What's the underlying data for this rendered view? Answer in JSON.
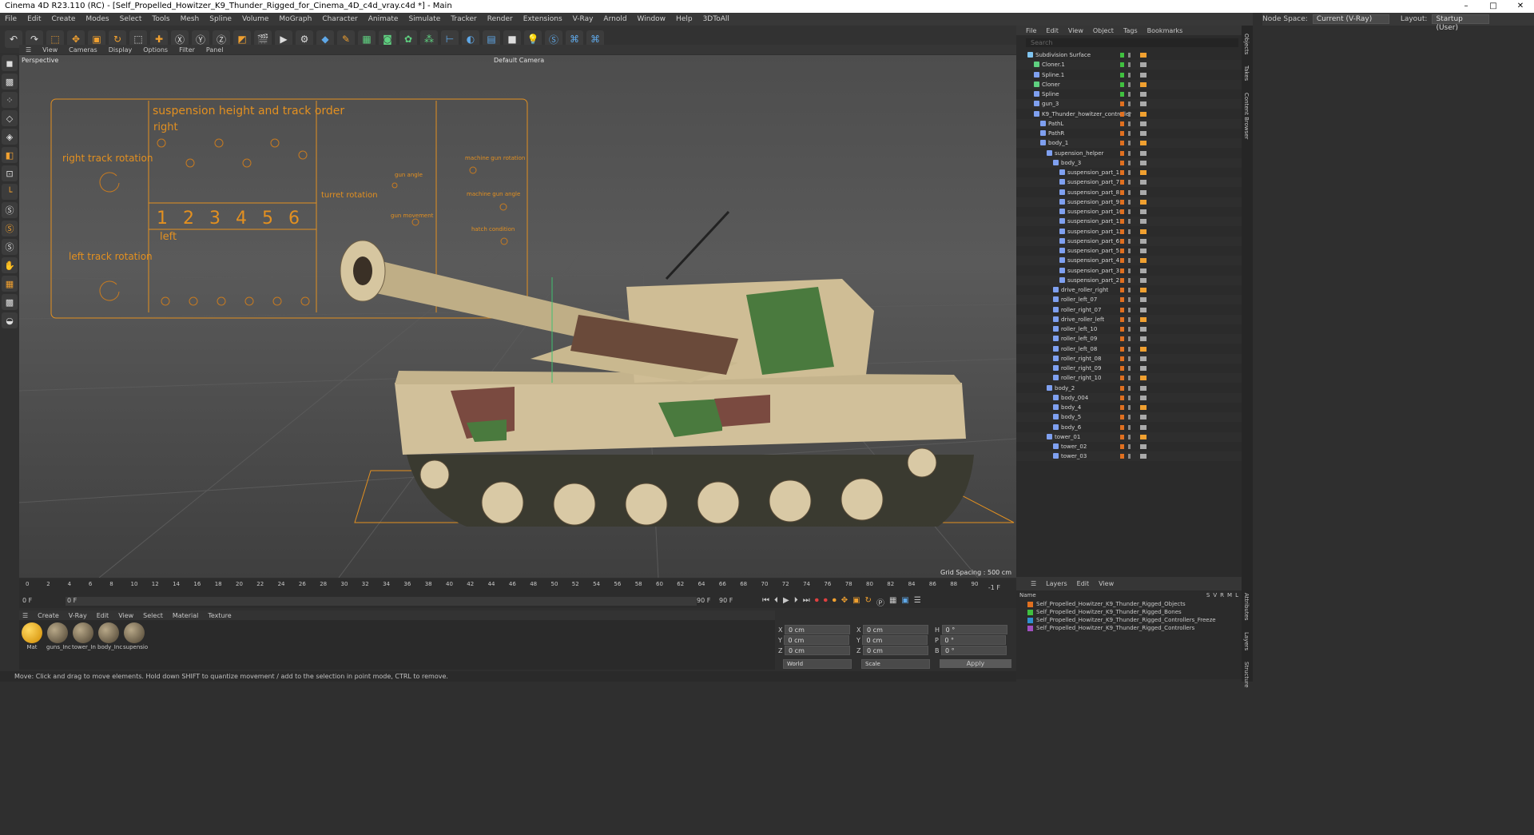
{
  "window": {
    "title": "Cinema 4D R23.110 (RC) - [Self_Propelled_Howitzer_K9_Thunder_Rigged_for_Cinema_4D_c4d_vray.c4d *] - Main"
  },
  "menu": [
    "File",
    "Edit",
    "Create",
    "Modes",
    "Select",
    "Tools",
    "Mesh",
    "Spline",
    "Volume",
    "MoGraph",
    "Character",
    "Animate",
    "Simulate",
    "Tracker",
    "Render",
    "Extensions",
    "V-Ray",
    "Arnold",
    "Window",
    "Help",
    "3DToAll"
  ],
  "node_space": {
    "label": "Node Space:",
    "value": "Current (V-Ray)"
  },
  "layout": {
    "label": "Layout:",
    "value": "Startup (User)"
  },
  "viewport": {
    "menu": [
      "View",
      "Cameras",
      "Display",
      "Options",
      "Filter",
      "Panel"
    ],
    "name": "Perspective",
    "camera": "Default Camera",
    "grid": "Grid Spacing : 500 cm",
    "overlay": {
      "suspension": "suspension height and track order",
      "right": "right",
      "left": "left",
      "rtrack": "right track rotation",
      "ltrack": "left track rotation",
      "turret": "turret rotation",
      "gunangle": "gun angle",
      "gunmove": "gun movement",
      "mgrot": "machine gun rotation",
      "mgangle": "machine gun angle",
      "hatch": "hatch condition",
      "numbers": [
        "1",
        "2",
        "3",
        "4",
        "5",
        "6"
      ]
    }
  },
  "timeline": {
    "ticks": [
      "0",
      "2",
      "4",
      "6",
      "8",
      "10",
      "12",
      "14",
      "16",
      "18",
      "20",
      "22",
      "24",
      "26",
      "28",
      "30",
      "32",
      "34",
      "36",
      "38",
      "40",
      "42",
      "44",
      "46",
      "48",
      "50",
      "52",
      "54",
      "56",
      "58",
      "60",
      "62",
      "64",
      "66",
      "68",
      "70",
      "72",
      "74",
      "76",
      "78",
      "80",
      "82",
      "84",
      "86",
      "88",
      "90"
    ],
    "end": "-1 F",
    "start": "0 F",
    "cur": "0 F",
    "max": "90 F",
    "max2": "90 F"
  },
  "materials": {
    "menu": [
      "Create",
      "V-Ray",
      "Edit",
      "View",
      "Select",
      "Material",
      "Texture"
    ],
    "items": [
      "Mat",
      "guns_Inc",
      "tower_In",
      "body_Inc",
      "supensio"
    ]
  },
  "coords": {
    "x": "X",
    "y": "Y",
    "z": "Z",
    "val": "0 cm",
    "h": "H",
    "p": "P",
    "b": "B",
    "deg": "0 °",
    "world": "World",
    "scale": "Scale",
    "apply": "Apply"
  },
  "status": "Move: Click and drag to move elements. Hold down SHIFT to quantize movement / add to the selection in point mode, CTRL to remove.",
  "om": {
    "menu": [
      "File",
      "Edit",
      "View",
      "Object",
      "Tags",
      "Bookmarks"
    ],
    "search": "Search",
    "objects": [
      {
        "n": "Subdivision Surface",
        "d": 0,
        "c": "#7fc4f0"
      },
      {
        "n": "Cloner.1",
        "d": 1,
        "c": "#5fd080"
      },
      {
        "n": "Spline.1",
        "d": 1,
        "c": "#7fa0f0"
      },
      {
        "n": "Cloner",
        "d": 1,
        "c": "#5fd080"
      },
      {
        "n": "Spline",
        "d": 1,
        "c": "#7fa0f0"
      },
      {
        "n": "gun_3",
        "d": 1,
        "c": "#7fa0f0"
      },
      {
        "n": "K9_Thunder_howitzer_controller",
        "d": 1,
        "c": "#7fa0f0"
      },
      {
        "n": "PathL",
        "d": 2,
        "c": "#7fa0f0"
      },
      {
        "n": "PathR",
        "d": 2,
        "c": "#7fa0f0"
      },
      {
        "n": "body_1",
        "d": 2,
        "c": "#7fa0f0"
      },
      {
        "n": "supension_helper",
        "d": 3,
        "c": "#7fa0f0"
      },
      {
        "n": "body_3",
        "d": 4,
        "c": "#7fa0f0"
      },
      {
        "n": "suspension_part_1",
        "d": 5,
        "c": "#7fa0f0"
      },
      {
        "n": "suspension_part_7",
        "d": 5,
        "c": "#7fa0f0"
      },
      {
        "n": "suspension_part_8",
        "d": 5,
        "c": "#7fa0f0"
      },
      {
        "n": "suspension_part_9",
        "d": 5,
        "c": "#7fa0f0"
      },
      {
        "n": "suspension_part_10",
        "d": 5,
        "c": "#7fa0f0"
      },
      {
        "n": "suspension_part_11",
        "d": 5,
        "c": "#7fa0f0"
      },
      {
        "n": "suspension_part_12",
        "d": 5,
        "c": "#7fa0f0"
      },
      {
        "n": "suspension_part_6",
        "d": 5,
        "c": "#7fa0f0"
      },
      {
        "n": "suspension_part_5",
        "d": 5,
        "c": "#7fa0f0"
      },
      {
        "n": "suspension_part_4",
        "d": 5,
        "c": "#7fa0f0"
      },
      {
        "n": "suspension_part_3",
        "d": 5,
        "c": "#7fa0f0"
      },
      {
        "n": "suspension_part_2",
        "d": 5,
        "c": "#7fa0f0"
      },
      {
        "n": "drive_roller_right",
        "d": 4,
        "c": "#7fa0f0"
      },
      {
        "n": "roller_left_07",
        "d": 4,
        "c": "#7fa0f0"
      },
      {
        "n": "roller_right_07",
        "d": 4,
        "c": "#7fa0f0"
      },
      {
        "n": "drive_roller_left",
        "d": 4,
        "c": "#7fa0f0"
      },
      {
        "n": "roller_left_10",
        "d": 4,
        "c": "#7fa0f0"
      },
      {
        "n": "roller_left_09",
        "d": 4,
        "c": "#7fa0f0"
      },
      {
        "n": "roller_left_08",
        "d": 4,
        "c": "#7fa0f0"
      },
      {
        "n": "roller_right_08",
        "d": 4,
        "c": "#7fa0f0"
      },
      {
        "n": "roller_right_09",
        "d": 4,
        "c": "#7fa0f0"
      },
      {
        "n": "roller_right_10",
        "d": 4,
        "c": "#7fa0f0"
      },
      {
        "n": "body_2",
        "d": 3,
        "c": "#7fa0f0"
      },
      {
        "n": "body_004",
        "d": 4,
        "c": "#7fa0f0"
      },
      {
        "n": "body_4",
        "d": 4,
        "c": "#7fa0f0"
      },
      {
        "n": "body_5",
        "d": 4,
        "c": "#7fa0f0"
      },
      {
        "n": "body_6",
        "d": 4,
        "c": "#7fa0f0"
      },
      {
        "n": "tower_01",
        "d": 3,
        "c": "#7fa0f0"
      },
      {
        "n": "tower_02",
        "d": 4,
        "c": "#7fa0f0"
      },
      {
        "n": "tower_03",
        "d": 4,
        "c": "#7fa0f0"
      }
    ]
  },
  "layers": {
    "menu": [
      "Layers",
      "Edit",
      "View"
    ],
    "col": "Name",
    "cols": [
      "S",
      "V",
      "R",
      "M",
      "L"
    ],
    "items": [
      {
        "n": "Self_Propelled_Howitzer_K9_Thunder_Rigged_Objects",
        "c": "#e07020"
      },
      {
        "n": "Self_Propelled_Howitzer_K9_Thunder_Rigged_Bones",
        "c": "#40c040"
      },
      {
        "n": "Self_Propelled_Howitzer_K9_Thunder_Rigged_Controllers_Freeze",
        "c": "#2f8fd0"
      },
      {
        "n": "Self_Propelled_Howitzer_K9_Thunder_Rigged_Controllers",
        "c": "#a050c0"
      }
    ]
  },
  "side_tabs": [
    "Objects",
    "Takes",
    "Content Browser",
    "Attributes",
    "Layers",
    "Structure"
  ]
}
